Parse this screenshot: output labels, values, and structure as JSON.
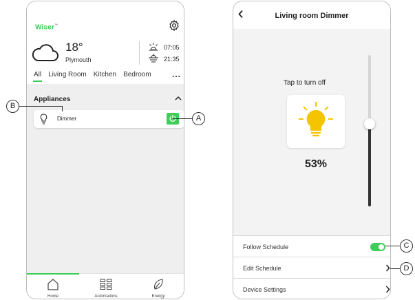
{
  "home": {
    "brand": "Wiser",
    "weather": {
      "icon": "cloud-icon",
      "temperature": "18°",
      "city": "Plymouth",
      "sunrise": "07:05",
      "sunset": "21:35"
    },
    "rooms": [
      "All",
      "Living Room",
      "Kitchen",
      "Bedroom"
    ],
    "more": "...",
    "group_title": "Appliances",
    "device": {
      "name": "Dimmer",
      "on": true
    },
    "nav": [
      {
        "label": "Home"
      },
      {
        "label": "Automations"
      },
      {
        "label": "Energy"
      }
    ]
  },
  "device_page": {
    "title": "Living room Dimmer",
    "hint": "Tap to turn off",
    "level": "53%",
    "level_value": 53,
    "settings": [
      {
        "label": "Follow Schedule",
        "control": "toggle",
        "on": true
      },
      {
        "label": "Edit Schedule",
        "control": "chevron"
      },
      {
        "label": "Device Settings",
        "control": "chevron"
      }
    ]
  },
  "callouts": {
    "a": "A",
    "b": "B",
    "c": "C",
    "d": "D"
  },
  "colors": {
    "accent": "#3dcd58",
    "bulb": "#f5c400"
  }
}
